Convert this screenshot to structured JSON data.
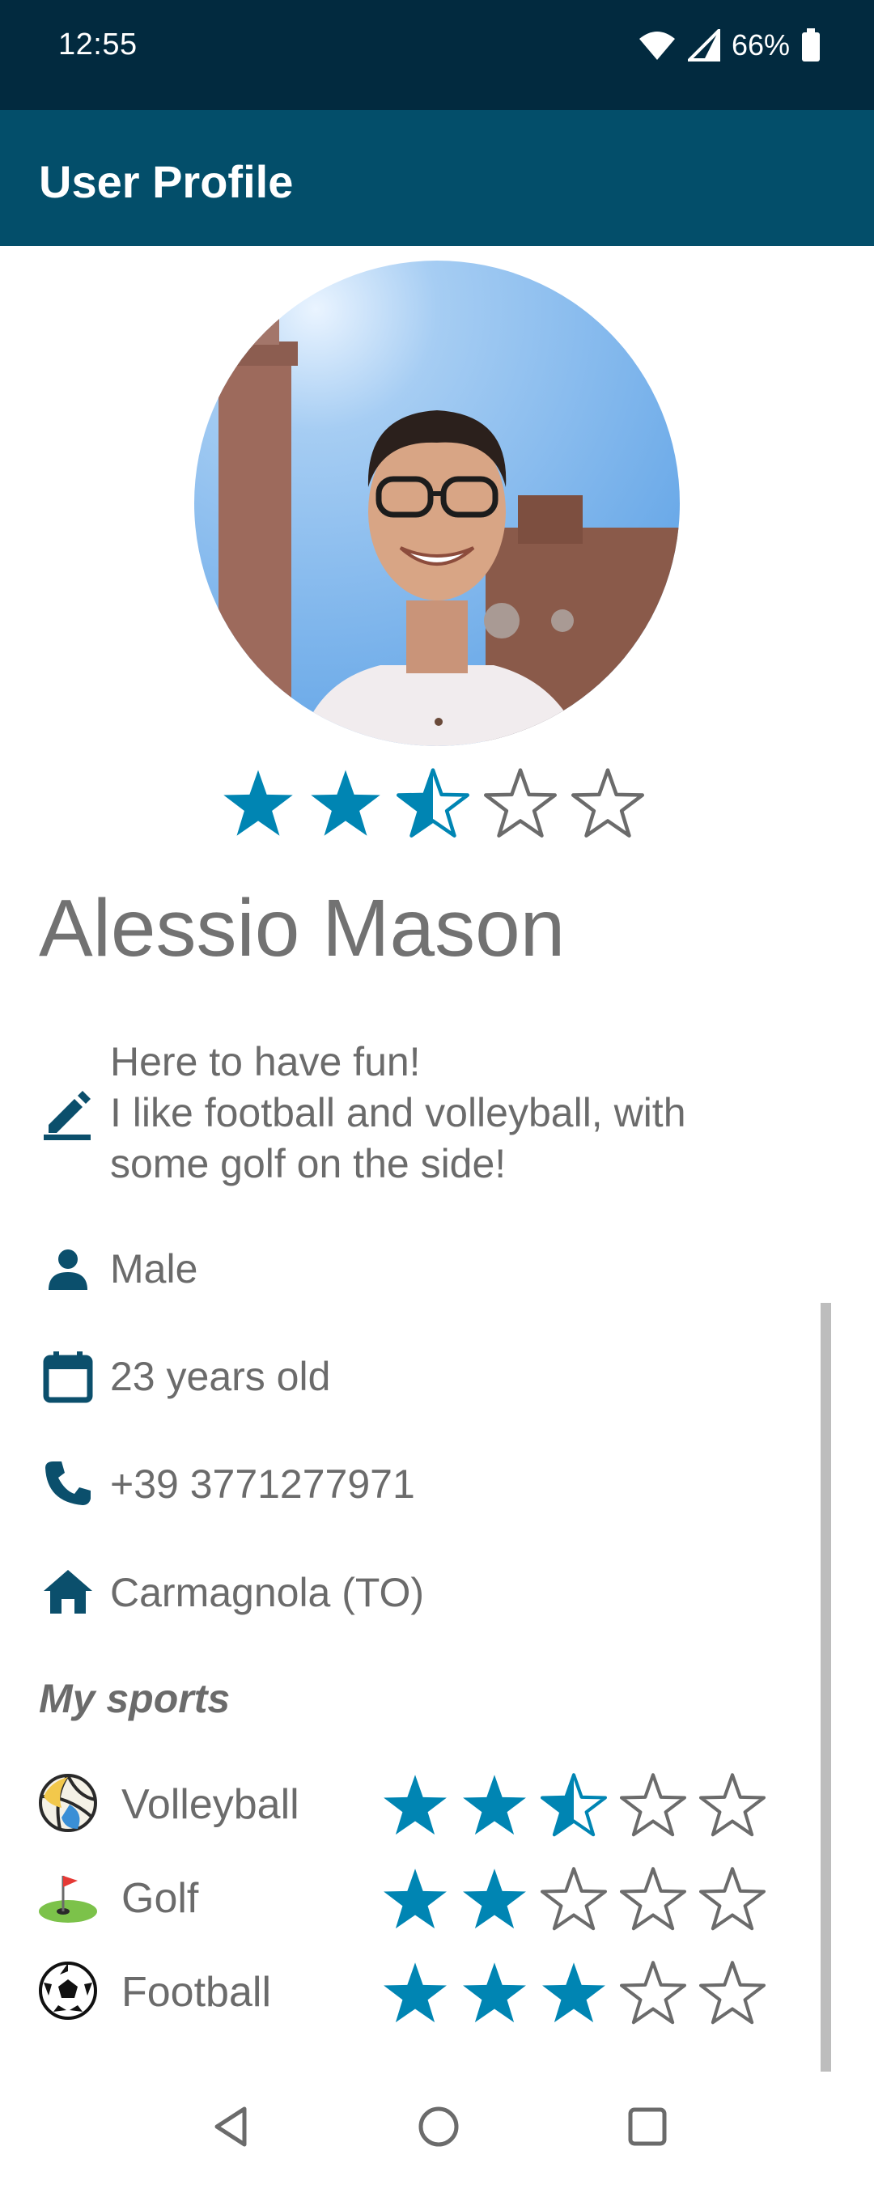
{
  "status_bar": {
    "time": "12:55",
    "battery": "66%"
  },
  "app_bar": {
    "title": "User Profile"
  },
  "profile": {
    "rating": 2.5,
    "name": "Alessio Mason",
    "bio": [
      "Here to have fun!",
      "I like football and volleyball, with",
      "some golf on the side!"
    ],
    "gender": "Male",
    "age": "23 years old",
    "phone": "+39 3771277971",
    "location": "Carmagnola (TO)"
  },
  "sports": {
    "title": "My sports",
    "items": [
      {
        "name": "Volleyball",
        "icon": "volleyball-icon",
        "rating": 2.5
      },
      {
        "name": "Golf",
        "icon": "golf-icon",
        "rating": 2
      },
      {
        "name": "Football",
        "icon": "football-icon",
        "rating": 3
      }
    ]
  },
  "colors": {
    "status_bar": "#022a3f",
    "app_bar": "#034e6a",
    "accent": "#0085b3",
    "icon": "#0b4f6c",
    "text": "#6b6b6b"
  }
}
